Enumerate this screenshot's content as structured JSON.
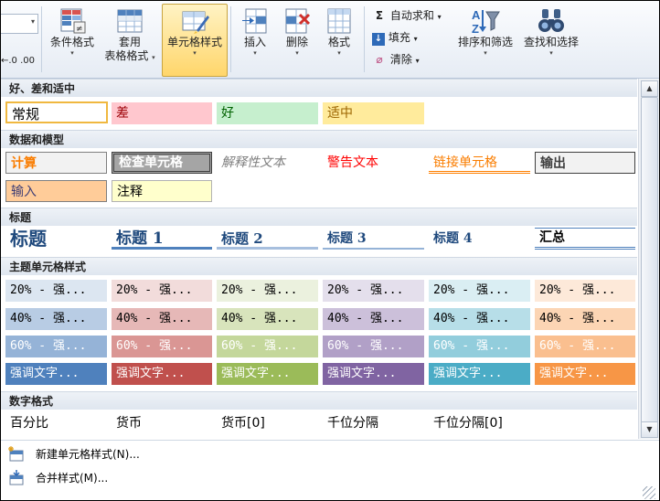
{
  "ribbon": {
    "conditional_format": {
      "line1": "条件格式"
    },
    "table_format": {
      "line1": "套用",
      "line2": "表格格式"
    },
    "cell_styles": {
      "line1": "单元格样式"
    },
    "insert": {
      "line1": "插入"
    },
    "delete": {
      "line1": "删除"
    },
    "format": {
      "line1": "格式"
    },
    "autosum": "自动求和",
    "fill": "填充",
    "clear": "清除",
    "sort_filter": "排序和筛选",
    "find_select": "查找和选择",
    "dropdown_glyph": "▾",
    "number_glyph": "←.0 .00"
  },
  "gallery": {
    "sections": {
      "good_bad": "好、差和适中",
      "data_model": "数据和模型",
      "titles": "标题",
      "theme": "主题单元格样式",
      "number": "数字格式"
    },
    "good_bad": [
      {
        "label": "常规",
        "bg": "#ffffff",
        "fg": "#000000"
      },
      {
        "label": "差",
        "bg": "#ffc7ce",
        "fg": "#9c0006"
      },
      {
        "label": "好",
        "bg": "#c6efce",
        "fg": "#006100"
      },
      {
        "label": "适中",
        "bg": "#ffeb9c",
        "fg": "#9c6500"
      }
    ],
    "data_model": [
      {
        "label": "计算"
      },
      {
        "label": "检查单元格"
      },
      {
        "label": "解释性文本"
      },
      {
        "label": "警告文本"
      },
      {
        "label": "链接单元格"
      },
      {
        "label": "输出"
      },
      {
        "label": "输入"
      },
      {
        "label": "注释"
      }
    ],
    "titles": [
      {
        "label": "标题"
      },
      {
        "label": "标题 1"
      },
      {
        "label": "标题 2"
      },
      {
        "label": "标题 3"
      },
      {
        "label": "标题 4"
      },
      {
        "label": "汇总"
      }
    ],
    "theme_rows": [
      {
        "label": "20% - 强...",
        "fg": "#000000",
        "colors": [
          "#dce6f1",
          "#f2dcdb",
          "#ebf1de",
          "#e4dfec",
          "#daeef3",
          "#fde9d9"
        ]
      },
      {
        "label": "40% - 强...",
        "fg": "#000000",
        "colors": [
          "#b8cce4",
          "#e6b8b7",
          "#d8e4bc",
          "#ccc0da",
          "#b7dee8",
          "#fcd5b4"
        ]
      },
      {
        "label": "60% - 强...",
        "fg": "#ffffff",
        "colors": [
          "#95b3d7",
          "#da9694",
          "#c4d79b",
          "#b1a0c7",
          "#92cddc",
          "#fabf8f"
        ]
      },
      {
        "label": "强调文字...",
        "fg": "#ffffff",
        "colors": [
          "#4f81bd",
          "#c0504d",
          "#9bbb59",
          "#8064a2",
          "#4bacc6",
          "#f79646"
        ]
      }
    ],
    "number": [
      {
        "label": "百分比"
      },
      {
        "label": "货币"
      },
      {
        "label": "货币[0]"
      },
      {
        "label": "千位分隔"
      },
      {
        "label": "千位分隔[0]"
      }
    ]
  },
  "scroll": {
    "up": "▲",
    "down": "▼"
  },
  "menu": {
    "new_style": "新建单元格样式(N)...",
    "merge_styles": "合并样式(M)..."
  }
}
